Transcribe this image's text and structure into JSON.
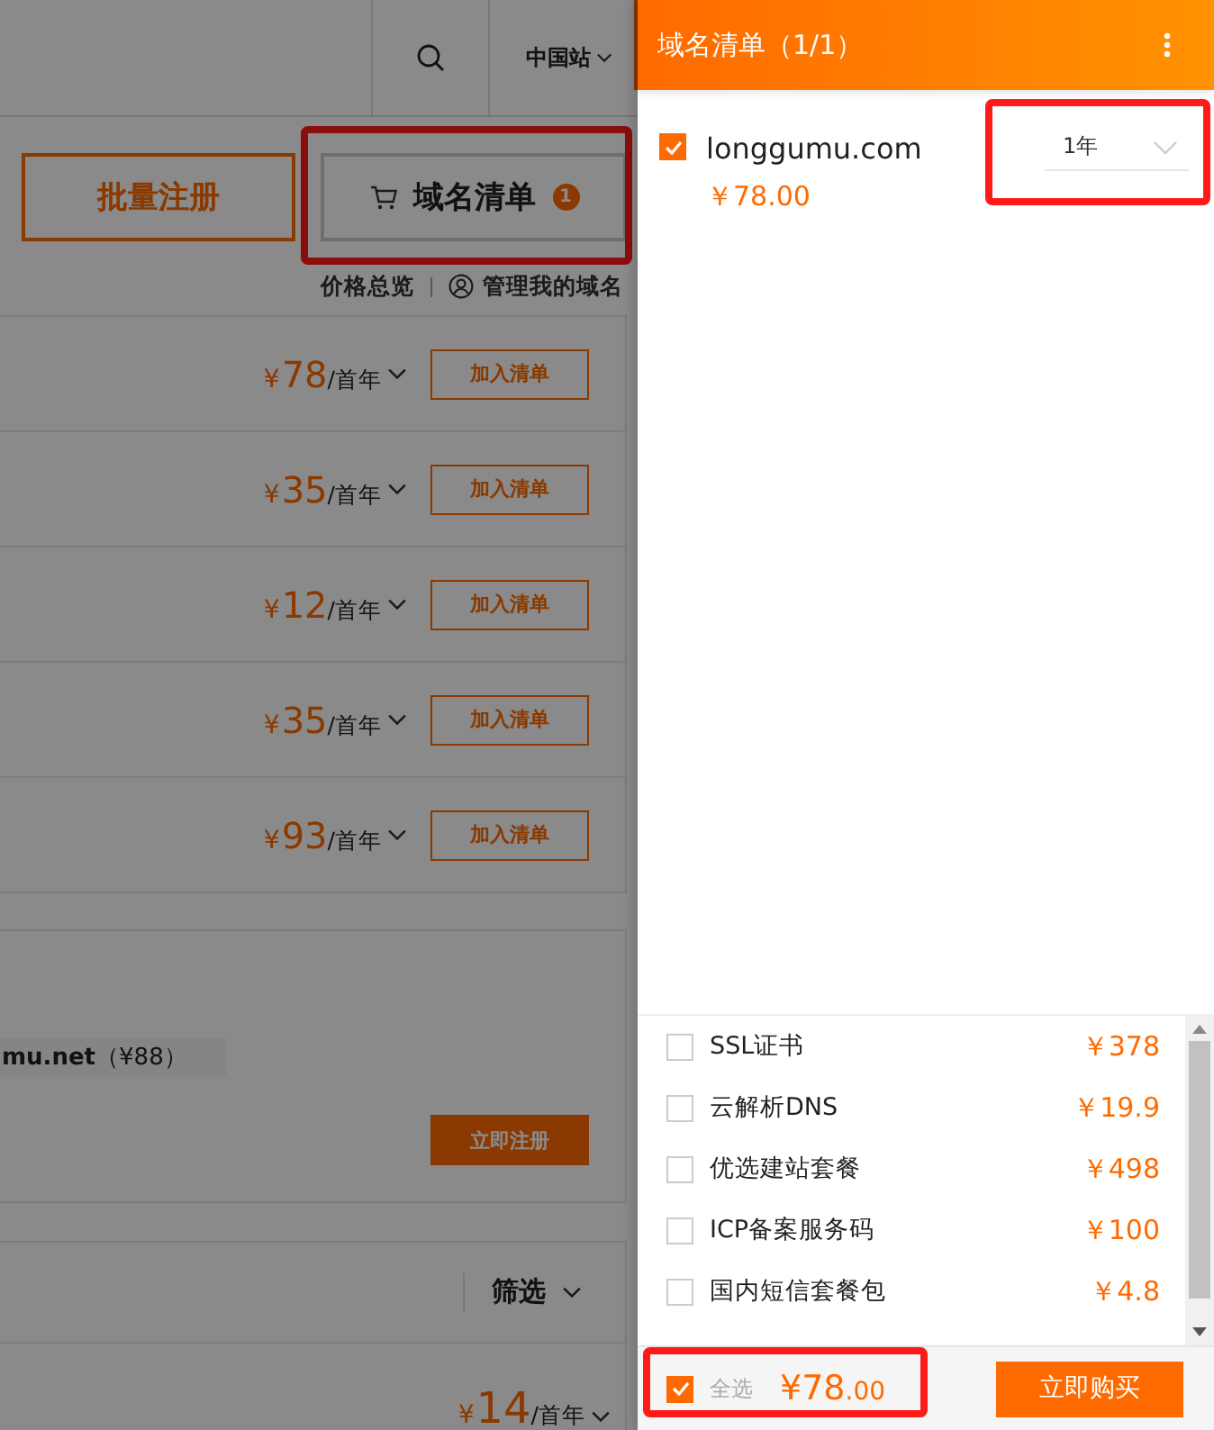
{
  "topbar": {
    "region": "中国站"
  },
  "actions": {
    "bulk_button": "批量注册",
    "cart_button": "域名清单",
    "cart_count": "1",
    "price_link": "价格总览",
    "manage_link": "管理我的域名"
  },
  "rows": [
    {
      "currency": "¥",
      "price": "78",
      "unit": "/首年",
      "button": "加入清单"
    },
    {
      "currency": "¥",
      "price": "35",
      "unit": "/首年",
      "button": "加入清单"
    },
    {
      "currency": "¥",
      "price": "12",
      "unit": "/首年",
      "button": "加入清单"
    },
    {
      "currency": "¥",
      "price": "35",
      "unit": "/首年",
      "button": "加入清单"
    },
    {
      "currency": "¥",
      "price": "93",
      "unit": "/首年",
      "button": "加入清单"
    }
  ],
  "suggestion": {
    "tag_domain": "mu.net",
    "tag_price": "（¥88）",
    "button": "立即注册"
  },
  "filter": {
    "label": "筛选"
  },
  "last_row": {
    "currency": "¥",
    "price": "14",
    "unit": "/首年"
  },
  "panel": {
    "title": "域名清单（1/1）",
    "items": [
      {
        "domain": "longgumu.com",
        "price": "￥78.00",
        "term": "1年",
        "checked": true
      }
    ],
    "services": [
      {
        "name": "SSL证书",
        "price": "￥378",
        "checked": false
      },
      {
        "name": "云解析DNS",
        "price": "￥19.9",
        "checked": false
      },
      {
        "name": "优选建站套餐",
        "price": "￥498",
        "checked": false
      },
      {
        "name": "ICP备案服务码",
        "price": "￥100",
        "checked": false
      },
      {
        "name": "国内短信套餐包",
        "price": "￥4.8",
        "checked": false
      }
    ],
    "select_all": {
      "label": "全选",
      "checked": true
    },
    "total": "¥78.00",
    "buy_button": "立即购买"
  },
  "highlights": {
    "cart_button": true,
    "term_select": true,
    "footer_total": true
  }
}
